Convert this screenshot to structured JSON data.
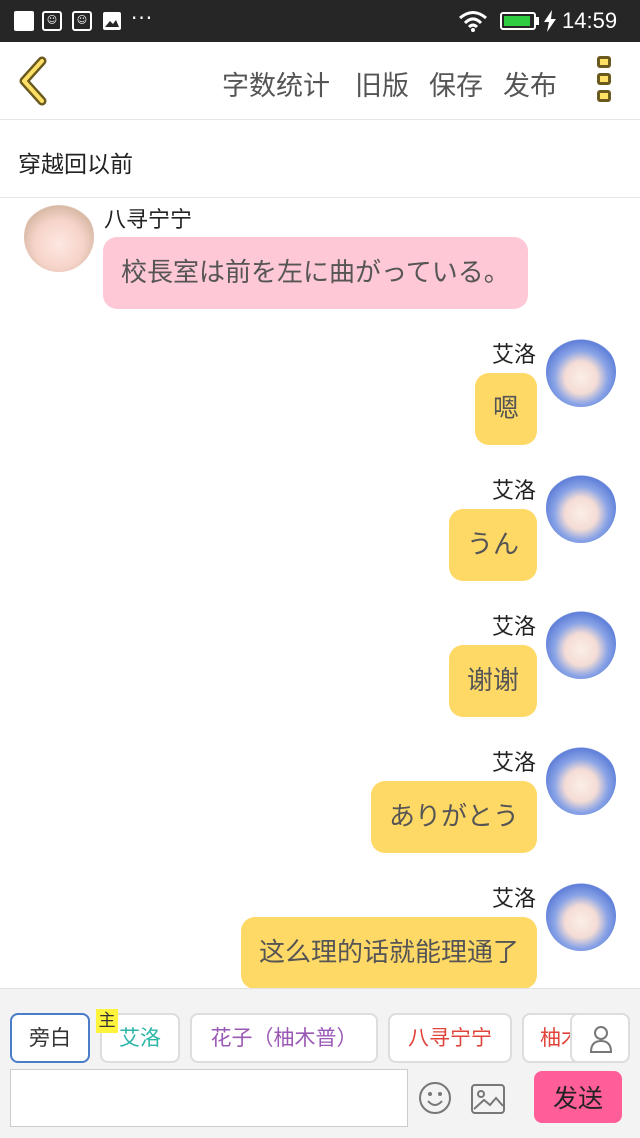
{
  "status_bar": {
    "time": "14:59",
    "more_indicator": "···",
    "notification_icons": [
      "square-icon",
      "app-icon",
      "app-icon",
      "image-icon"
    ]
  },
  "toolbar": {
    "word_count_label": "字数统计",
    "old_version_label": "旧版",
    "save_label": "保存",
    "publish_label": "发布"
  },
  "title": "穿越回以前",
  "messages": [
    {
      "sender": "八寻宁宁",
      "text": "校長室は前を左に曲がっている。",
      "side": "left"
    },
    {
      "sender": "艾洛",
      "text": "嗯",
      "side": "right"
    },
    {
      "sender": "艾洛",
      "text": "うん",
      "side": "right"
    },
    {
      "sender": "艾洛",
      "text": "谢谢",
      "side": "right"
    },
    {
      "sender": "艾洛",
      "text": "ありがとう",
      "side": "right"
    },
    {
      "sender": "艾洛",
      "text": "这么理的话就能理通了",
      "side": "right"
    }
  ],
  "role_bar": {
    "master_tag": "主",
    "roles": [
      "旁白",
      "艾洛",
      "花子（柚木普）",
      "八寻宁宁",
      "柚木"
    ],
    "role_colors": [
      "#333333",
      "#2bb5a8",
      "#9b59b6",
      "#e0433a",
      "#e0433a"
    ]
  },
  "input": {
    "placeholder": "",
    "send_label": "发送"
  },
  "colors": {
    "accent_pink": "#ff5e98",
    "bubble_pink": "#ffc8d6",
    "bubble_yellow": "#ffd966"
  }
}
